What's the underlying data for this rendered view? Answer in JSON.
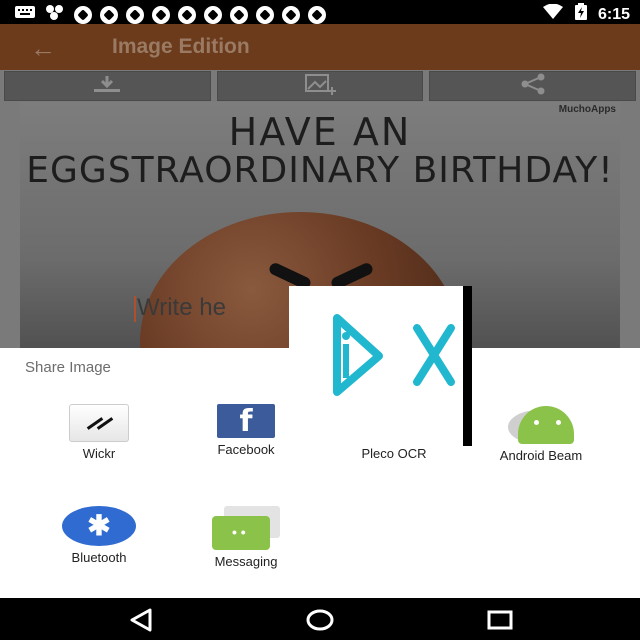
{
  "status_bar": {
    "time": "6:15",
    "icons": [
      "keyboard-icon",
      "bubbles-icon",
      "soccer-icon",
      "soccer-icon",
      "soccer-icon",
      "soccer-icon",
      "soccer-icon",
      "soccer-icon",
      "soccer-icon",
      "soccer-icon",
      "soccer-icon",
      "soccer-icon",
      "wifi-icon",
      "battery-charging-icon"
    ]
  },
  "app": {
    "title": "Image Edition",
    "toolbar": [
      "download-icon",
      "add-image-icon",
      "share-icon"
    ],
    "image": {
      "watermark": "MuchoApps",
      "headline_line1": "HAVE AN",
      "headline_line2": "EGGSTRAORDINARY BIRTHDAY!",
      "text_field_placeholder": "Write here...",
      "text_field_visible": "Write he"
    }
  },
  "share_sheet": {
    "title": "Share Image",
    "apps": [
      {
        "label": "Wickr",
        "icon": "wickr-icon"
      },
      {
        "label": "Facebook",
        "icon": "facebook-icon"
      },
      {
        "label": "Pleco OCR",
        "icon": "pleco-ocr-icon"
      },
      {
        "label": "Android Beam",
        "icon": "android-beam-icon"
      },
      {
        "label": "Bluetooth",
        "icon": "bluetooth-icon"
      },
      {
        "label": "Messaging",
        "icon": "messaging-icon"
      }
    ]
  },
  "overlay": {
    "logo": "px-logo"
  },
  "nav_bar": {
    "buttons": [
      "back-icon",
      "home-icon",
      "recents-icon"
    ]
  },
  "colors": {
    "app_bar": "#6b3b1c",
    "facebook": "#3b5b9a",
    "android_green": "#8bc34a",
    "bluetooth_blue": "#2f6bd0",
    "logo_cyan": "#21b7cf"
  }
}
